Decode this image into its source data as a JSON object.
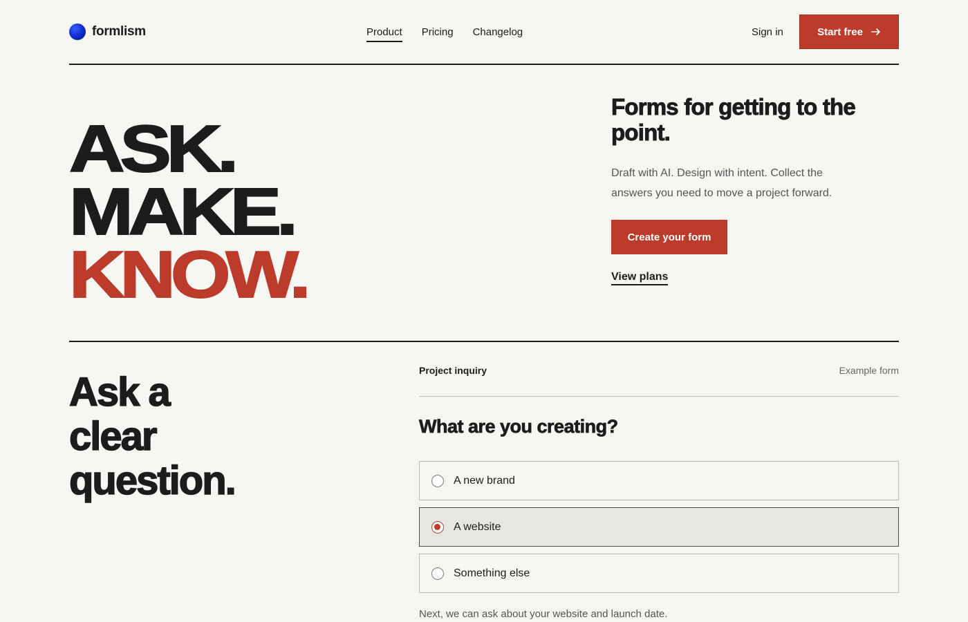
{
  "brand": {
    "name": "formlism",
    "accent": "#bd3b2b",
    "logo_color": "#1232d6"
  },
  "nav": {
    "items": [
      {
        "label": "Product",
        "active": true
      },
      {
        "label": "Pricing",
        "active": false
      },
      {
        "label": "Changelog",
        "active": false
      }
    ],
    "sign_in": "Sign in",
    "cta": "Start free",
    "cta_icon": "arrow-right-icon"
  },
  "hero": {
    "big_words": [
      "ASK.",
      "MAKE.",
      "KNOW."
    ],
    "title": "Forms for getting to the point.",
    "description": "Draft with AI. Design with intent. Collect the answers you need to move a project forward.",
    "primary_button": "Create your form",
    "secondary_link": "View plans"
  },
  "section": {
    "title_lines": [
      "Ask a",
      "clear",
      "question."
    ],
    "form": {
      "name": "Project inquiry",
      "tag": "Example form",
      "question": "What are you creating?",
      "options": [
        {
          "label": "A new brand",
          "selected": false
        },
        {
          "label": "A website",
          "selected": true
        },
        {
          "label": "Something else",
          "selected": false
        }
      ],
      "note": "Next, we can ask about your website and launch date."
    }
  }
}
